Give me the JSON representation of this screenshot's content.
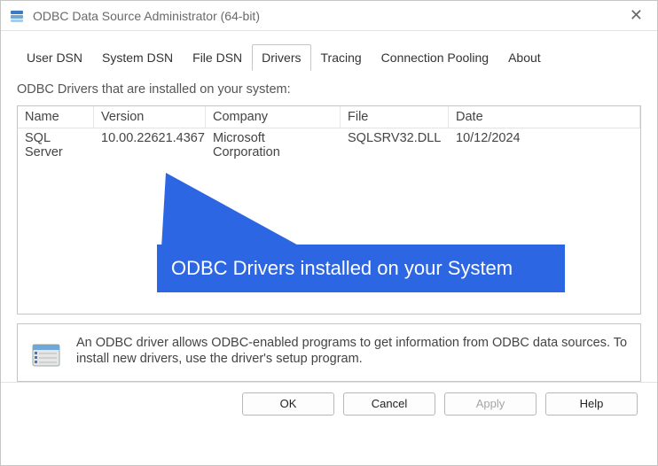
{
  "window": {
    "title": "ODBC Data Source Administrator (64-bit)"
  },
  "tabs": [
    {
      "label": "User DSN"
    },
    {
      "label": "System DSN"
    },
    {
      "label": "File DSN"
    },
    {
      "label": "Drivers",
      "active": true
    },
    {
      "label": "Tracing"
    },
    {
      "label": "Connection Pooling"
    },
    {
      "label": "About"
    }
  ],
  "panel": {
    "intro": "ODBC Drivers that are installed on your system:",
    "columns": {
      "name": "Name",
      "version": "Version",
      "company": "Company",
      "file": "File",
      "date": "Date"
    },
    "rows": [
      {
        "name": "SQL Server",
        "version": "10.00.22621.4367",
        "company": "Microsoft Corporation",
        "file": "SQLSRV32.DLL",
        "date": "10/12/2024"
      }
    ],
    "info": "An ODBC driver allows ODBC-enabled programs to get information from ODBC data sources.  To install new drivers, use the driver's setup program."
  },
  "buttons": {
    "ok": "OK",
    "cancel": "Cancel",
    "apply": "Apply",
    "help": "Help"
  },
  "annotation": {
    "label": "ODBC Drivers installed on your System"
  },
  "colors": {
    "annotation_bg": "#2d66e3"
  }
}
